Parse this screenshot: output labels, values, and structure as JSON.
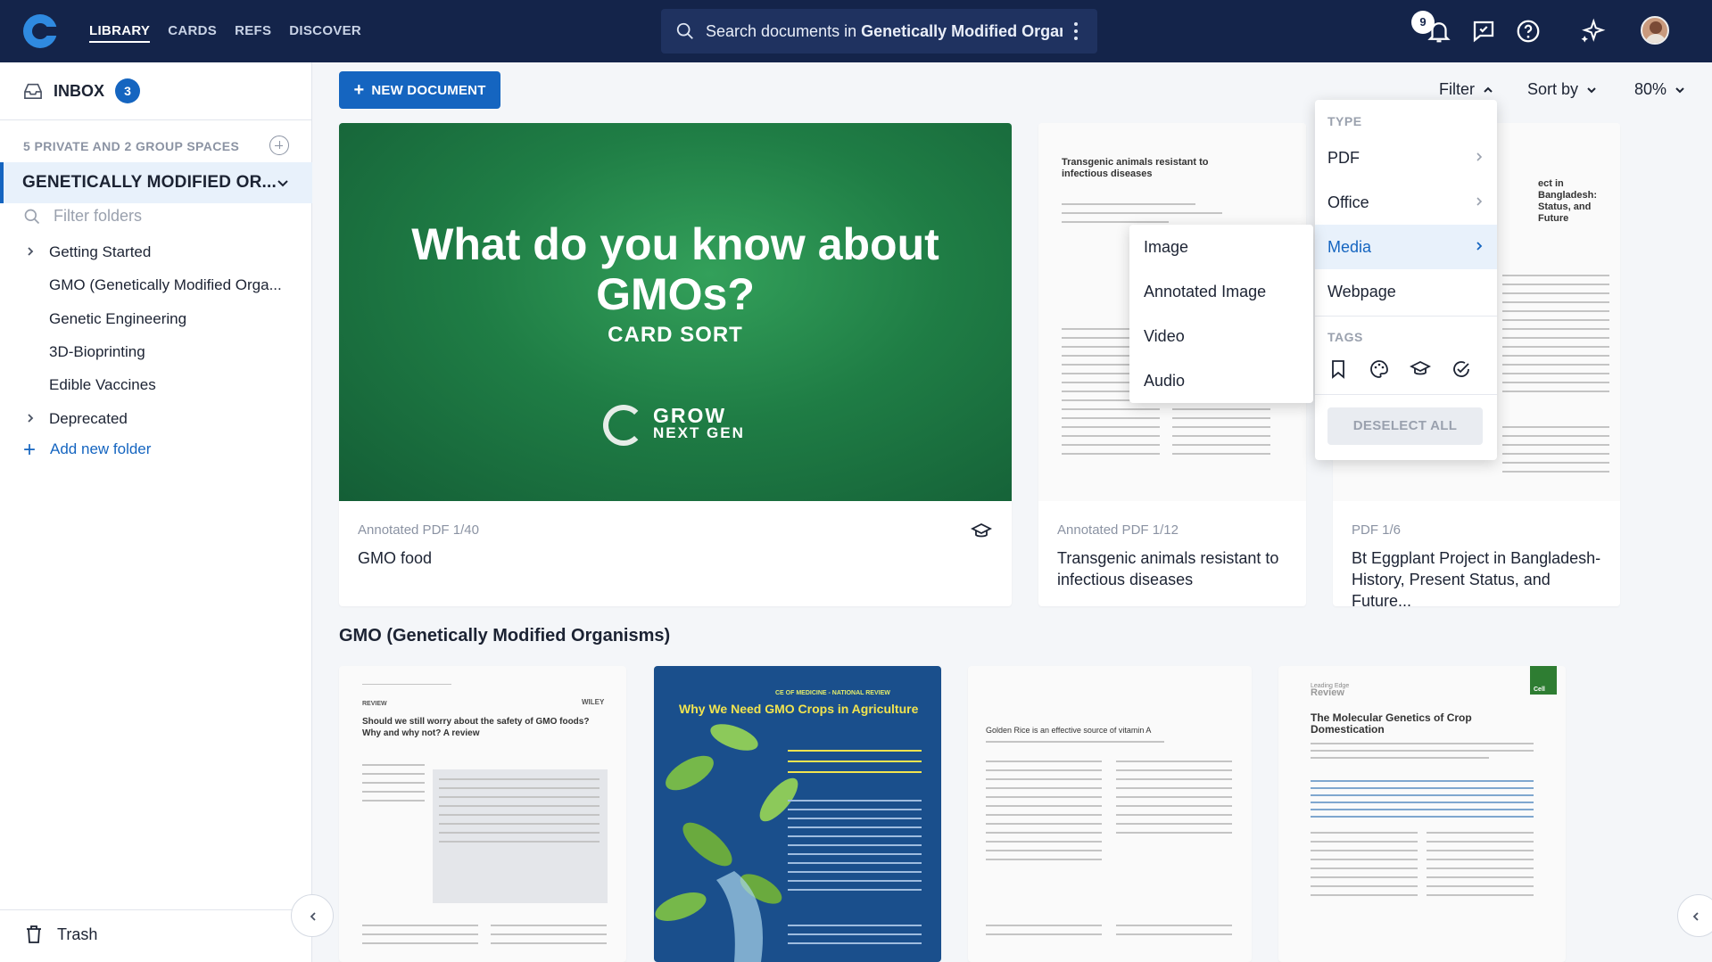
{
  "nav": {
    "items": [
      "LIBRARY",
      "CARDS",
      "REFS",
      "DISCOVER"
    ],
    "active": "LIBRARY"
  },
  "search": {
    "prefix": "Search documents in ",
    "scope": "Genetically Modified Organis..."
  },
  "notifications": {
    "count": "9"
  },
  "sidebar": {
    "inbox_label": "INBOX",
    "inbox_count": "3",
    "spaces_label": "5 PRIVATE AND 2 GROUP SPACES",
    "selected_space": "GENETICALLY MODIFIED OR...",
    "filter_placeholder": "Filter folders",
    "folders": [
      {
        "label": "Getting Started",
        "expandable": true
      },
      {
        "label": "GMO (Genetically Modified Orga...",
        "expandable": false
      },
      {
        "label": "Genetic Engineering",
        "expandable": false
      },
      {
        "label": "3D-Bioprinting",
        "expandable": false
      },
      {
        "label": "Edible Vaccines",
        "expandable": false
      },
      {
        "label": "Deprecated",
        "expandable": true
      }
    ],
    "add_folder": "Add new folder",
    "trash": "Trash"
  },
  "toolbar": {
    "new_document": "NEW DOCUMENT",
    "filter": "Filter",
    "sort": "Sort by",
    "zoom": "80%"
  },
  "cards_top": [
    {
      "meta": "Annotated PDF   1/40",
      "title": "GMO food",
      "thumb_heading": "What do you know about GMOs?",
      "thumb_sub": "CARD SORT",
      "thumb_brand_line1": "GROW",
      "thumb_brand_line2": "NEXT GEN"
    },
    {
      "meta": "Annotated PDF   1/12",
      "title": "Transgenic animals resistant to infectious diseases",
      "thumb_title": "Transgenic animals resistant to infectious diseases"
    },
    {
      "meta": "PDF   1/6",
      "title": "Bt Eggplant Project in Bangladesh-History, Present Status, and Future...",
      "thumb_title": "ect in Bangladesh: Status, and Future"
    }
  ],
  "section_title": "GMO (Genetically Modified Organisms)",
  "cards_bottom": [
    {
      "thumb_title": "Should we still worry about the safety of GMO foods? Why and why not? A review",
      "kicker": "REVIEW",
      "publisher": "WILEY"
    },
    {
      "thumb_title": "Why We Need GMO Crops in Agriculture",
      "kicker": "CE OF MEDICINE - NATIONAL REVIEW"
    },
    {
      "thumb_title": "Golden Rice is an effective source of vitamin A"
    },
    {
      "thumb_title": "The Molecular Genetics of Crop Domestication",
      "kicker": "Leading Edge",
      "section": "Review",
      "journal": "Cell"
    }
  ],
  "filter_menu": {
    "type_label": "TYPE",
    "types": [
      "PDF",
      "Office",
      "Media",
      "Webpage"
    ],
    "selected": "Media",
    "tags_label": "TAGS",
    "deselect_all": "DESELECT ALL",
    "media_options": [
      "Image",
      "Annotated Image",
      "Video",
      "Audio"
    ]
  },
  "colors": {
    "topbar": "#14244a",
    "accent": "#1565c0",
    "selected_bg": "#e8f1fb"
  }
}
